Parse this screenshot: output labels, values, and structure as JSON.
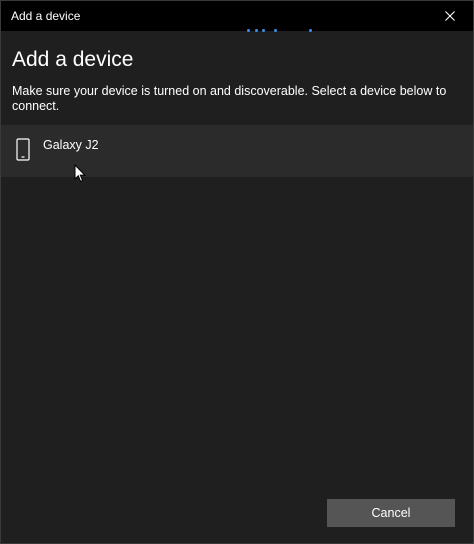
{
  "window": {
    "title": "Add a device"
  },
  "heading": "Add a device",
  "description": "Make sure your device is turned on and discoverable. Select a device below to connect.",
  "devices": [
    {
      "label": "Galaxy J2",
      "icon": "phone-icon"
    }
  ],
  "actions": {
    "cancel_label": "Cancel"
  },
  "colors": {
    "titlebar": "#000000",
    "background": "#1f1f1f",
    "device_row": "#2b2b2b",
    "button": "#555555",
    "progress": "#3a8fe6"
  },
  "icons": {
    "close": "close-icon",
    "device": "phone-icon",
    "cursor": "mouse-pointer-icon"
  }
}
